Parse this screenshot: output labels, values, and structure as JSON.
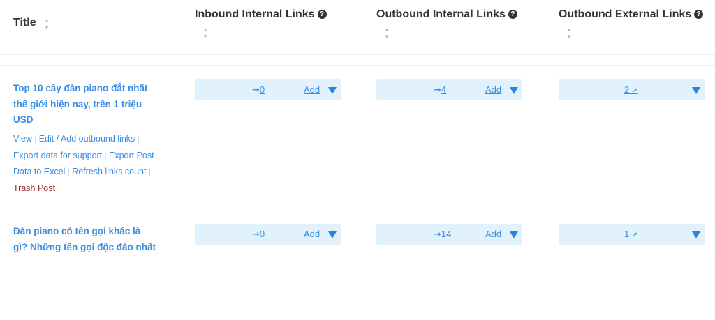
{
  "columns": {
    "title": "Title",
    "inbound": "Inbound Internal Links",
    "outbound_internal": "Outbound Internal Links",
    "outbound_external": "Outbound External Links",
    "help_glyph": "?"
  },
  "sort_glyphs": {
    "up": "▲",
    "down": "▼"
  },
  "rows": [
    {
      "title": "Top 10 cây đàn piano đắt nhất thế giới hiện nay, trên 1 triệu USD",
      "actions": {
        "view": "View",
        "edit": "Edit / Add outbound links",
        "export_support": "Export data for support",
        "export_excel": "Export Post Data to Excel",
        "refresh": "Refresh links count",
        "trash": "Trash Post",
        "sep": "|"
      },
      "inbound": "0",
      "outbound_internal": "4",
      "outbound_external": "2",
      "add_label": "Add"
    },
    {
      "title": "Đàn piano có tên gọi khác là gì? Những tên gọi độc đáo nhất",
      "inbound": "0",
      "outbound_internal": "14",
      "outbound_external": "1",
      "add_label": "Add"
    }
  ],
  "icons": {
    "internal_arrow": "arrow-right-icon",
    "external_arrow": "arrow-up-right-icon",
    "dropdown": "caret-down-icon"
  },
  "colors": {
    "link": "#3a8ee6",
    "cell_bg": "#e1f2fd",
    "trash": "#a12c2c",
    "caret": "#2f80dc"
  }
}
